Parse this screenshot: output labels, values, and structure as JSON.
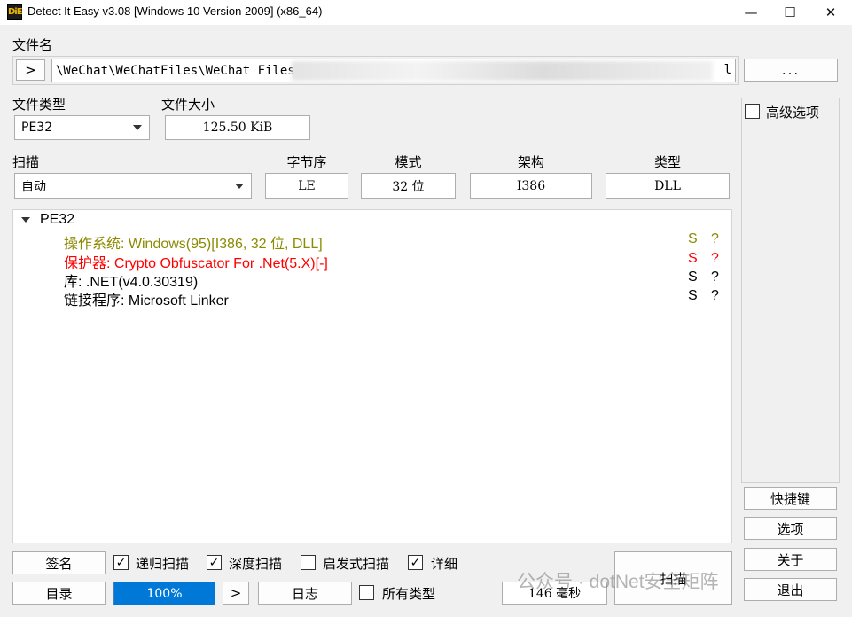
{
  "window": {
    "app_icon": "DiE",
    "title": "Detect It Easy v3.08 [Windows 10 Version 2009] (x86_64)",
    "minimize_icon": "—",
    "maximize_icon": "☐",
    "close_icon": "✕"
  },
  "file": {
    "label": "文件名",
    "expand_icon": ">",
    "path_visible": "\\WeChat\\WeChatFiles\\WeChat Files\\",
    "path_tail": "l",
    "browse_label": "..."
  },
  "filetype": {
    "label": "文件类型",
    "value": "PE32"
  },
  "filesize": {
    "label": "文件大小",
    "value": "125.50 KiB"
  },
  "scan": {
    "label": "扫描",
    "value": "自动"
  },
  "props": {
    "endian": {
      "label": "字节序",
      "value": "LE"
    },
    "mode": {
      "label": "模式",
      "value": "32 位"
    },
    "arch": {
      "label": "架构",
      "value": "I386"
    },
    "type": {
      "label": "类型",
      "value": "DLL"
    }
  },
  "advanced": {
    "label": "高级选项"
  },
  "results": {
    "root": "PE32",
    "items": [
      {
        "text": "操作系统: Windows(95)[I386, 32 位, DLL]",
        "s": "S",
        "q": "?",
        "color": "#8c8a00"
      },
      {
        "text": "保护器: Crypto Obfuscator For .Net(5.X)[-]",
        "s": "S",
        "q": "?",
        "color": "#ff0000"
      },
      {
        "text": "库: .NET(v4.0.30319)",
        "s": "S",
        "q": "?",
        "color": "#000000"
      },
      {
        "text": "链接程序: Microsoft Linker",
        "s": "S",
        "q": "?",
        "color": "#000000"
      }
    ]
  },
  "bottom": {
    "signature": "签名",
    "recursive": {
      "label": "递归扫描",
      "checked": true
    },
    "deep": {
      "label": "深度扫描",
      "checked": true
    },
    "heuristic": {
      "label": "启发式扫描",
      "checked": false
    },
    "verbose": {
      "label": "详细",
      "checked": true
    },
    "directory": "目录",
    "progress": "100%",
    "progress_value": 100,
    "next_icon": ">",
    "log": "日志",
    "all_types": {
      "label": "所有类型",
      "checked": false
    },
    "time": "146 毫秒",
    "scan_button": "扫描"
  },
  "side": {
    "shortcuts": "快捷键",
    "options": "选项",
    "about": "关于",
    "exit": "退出"
  },
  "watermark": "公众号 · dotNet安全矩阵",
  "colors": {
    "progress_fill": "#0078d7",
    "progress_border": "#4a7fb5"
  }
}
